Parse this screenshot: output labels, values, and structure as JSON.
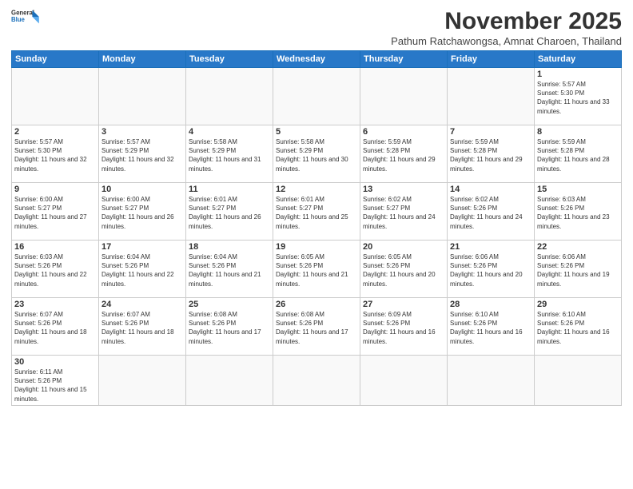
{
  "logo": {
    "general": "General",
    "blue": "Blue"
  },
  "header": {
    "title": "November 2025",
    "subtitle": "Pathum Ratchawongsa, Amnat Charoen, Thailand"
  },
  "weekdays": [
    "Sunday",
    "Monday",
    "Tuesday",
    "Wednesday",
    "Thursday",
    "Friday",
    "Saturday"
  ],
  "days": {
    "d1": {
      "num": "1",
      "sunrise": "Sunrise: 5:57 AM",
      "sunset": "Sunset: 5:30 PM",
      "daylight": "Daylight: 11 hours and 33 minutes."
    },
    "d2": {
      "num": "2",
      "sunrise": "Sunrise: 5:57 AM",
      "sunset": "Sunset: 5:30 PM",
      "daylight": "Daylight: 11 hours and 32 minutes."
    },
    "d3": {
      "num": "3",
      "sunrise": "Sunrise: 5:57 AM",
      "sunset": "Sunset: 5:29 PM",
      "daylight": "Daylight: 11 hours and 32 minutes."
    },
    "d4": {
      "num": "4",
      "sunrise": "Sunrise: 5:58 AM",
      "sunset": "Sunset: 5:29 PM",
      "daylight": "Daylight: 11 hours and 31 minutes."
    },
    "d5": {
      "num": "5",
      "sunrise": "Sunrise: 5:58 AM",
      "sunset": "Sunset: 5:29 PM",
      "daylight": "Daylight: 11 hours and 30 minutes."
    },
    "d6": {
      "num": "6",
      "sunrise": "Sunrise: 5:59 AM",
      "sunset": "Sunset: 5:28 PM",
      "daylight": "Daylight: 11 hours and 29 minutes."
    },
    "d7": {
      "num": "7",
      "sunrise": "Sunrise: 5:59 AM",
      "sunset": "Sunset: 5:28 PM",
      "daylight": "Daylight: 11 hours and 29 minutes."
    },
    "d8": {
      "num": "8",
      "sunrise": "Sunrise: 5:59 AM",
      "sunset": "Sunset: 5:28 PM",
      "daylight": "Daylight: 11 hours and 28 minutes."
    },
    "d9": {
      "num": "9",
      "sunrise": "Sunrise: 6:00 AM",
      "sunset": "Sunset: 5:27 PM",
      "daylight": "Daylight: 11 hours and 27 minutes."
    },
    "d10": {
      "num": "10",
      "sunrise": "Sunrise: 6:00 AM",
      "sunset": "Sunset: 5:27 PM",
      "daylight": "Daylight: 11 hours and 26 minutes."
    },
    "d11": {
      "num": "11",
      "sunrise": "Sunrise: 6:01 AM",
      "sunset": "Sunset: 5:27 PM",
      "daylight": "Daylight: 11 hours and 26 minutes."
    },
    "d12": {
      "num": "12",
      "sunrise": "Sunrise: 6:01 AM",
      "sunset": "Sunset: 5:27 PM",
      "daylight": "Daylight: 11 hours and 25 minutes."
    },
    "d13": {
      "num": "13",
      "sunrise": "Sunrise: 6:02 AM",
      "sunset": "Sunset: 5:27 PM",
      "daylight": "Daylight: 11 hours and 24 minutes."
    },
    "d14": {
      "num": "14",
      "sunrise": "Sunrise: 6:02 AM",
      "sunset": "Sunset: 5:26 PM",
      "daylight": "Daylight: 11 hours and 24 minutes."
    },
    "d15": {
      "num": "15",
      "sunrise": "Sunrise: 6:03 AM",
      "sunset": "Sunset: 5:26 PM",
      "daylight": "Daylight: 11 hours and 23 minutes."
    },
    "d16": {
      "num": "16",
      "sunrise": "Sunrise: 6:03 AM",
      "sunset": "Sunset: 5:26 PM",
      "daylight": "Daylight: 11 hours and 22 minutes."
    },
    "d17": {
      "num": "17",
      "sunrise": "Sunrise: 6:04 AM",
      "sunset": "Sunset: 5:26 PM",
      "daylight": "Daylight: 11 hours and 22 minutes."
    },
    "d18": {
      "num": "18",
      "sunrise": "Sunrise: 6:04 AM",
      "sunset": "Sunset: 5:26 PM",
      "daylight": "Daylight: 11 hours and 21 minutes."
    },
    "d19": {
      "num": "19",
      "sunrise": "Sunrise: 6:05 AM",
      "sunset": "Sunset: 5:26 PM",
      "daylight": "Daylight: 11 hours and 21 minutes."
    },
    "d20": {
      "num": "20",
      "sunrise": "Sunrise: 6:05 AM",
      "sunset": "Sunset: 5:26 PM",
      "daylight": "Daylight: 11 hours and 20 minutes."
    },
    "d21": {
      "num": "21",
      "sunrise": "Sunrise: 6:06 AM",
      "sunset": "Sunset: 5:26 PM",
      "daylight": "Daylight: 11 hours and 20 minutes."
    },
    "d22": {
      "num": "22",
      "sunrise": "Sunrise: 6:06 AM",
      "sunset": "Sunset: 5:26 PM",
      "daylight": "Daylight: 11 hours and 19 minutes."
    },
    "d23": {
      "num": "23",
      "sunrise": "Sunrise: 6:07 AM",
      "sunset": "Sunset: 5:26 PM",
      "daylight": "Daylight: 11 hours and 18 minutes."
    },
    "d24": {
      "num": "24",
      "sunrise": "Sunrise: 6:07 AM",
      "sunset": "Sunset: 5:26 PM",
      "daylight": "Daylight: 11 hours and 18 minutes."
    },
    "d25": {
      "num": "25",
      "sunrise": "Sunrise: 6:08 AM",
      "sunset": "Sunset: 5:26 PM",
      "daylight": "Daylight: 11 hours and 17 minutes."
    },
    "d26": {
      "num": "26",
      "sunrise": "Sunrise: 6:08 AM",
      "sunset": "Sunset: 5:26 PM",
      "daylight": "Daylight: 11 hours and 17 minutes."
    },
    "d27": {
      "num": "27",
      "sunrise": "Sunrise: 6:09 AM",
      "sunset": "Sunset: 5:26 PM",
      "daylight": "Daylight: 11 hours and 16 minutes."
    },
    "d28": {
      "num": "28",
      "sunrise": "Sunrise: 6:10 AM",
      "sunset": "Sunset: 5:26 PM",
      "daylight": "Daylight: 11 hours and 16 minutes."
    },
    "d29": {
      "num": "29",
      "sunrise": "Sunrise: 6:10 AM",
      "sunset": "Sunset: 5:26 PM",
      "daylight": "Daylight: 11 hours and 16 minutes."
    },
    "d30": {
      "num": "30",
      "sunrise": "Sunrise: 6:11 AM",
      "sunset": "Sunset: 5:26 PM",
      "daylight": "Daylight: 11 hours and 15 minutes."
    }
  }
}
